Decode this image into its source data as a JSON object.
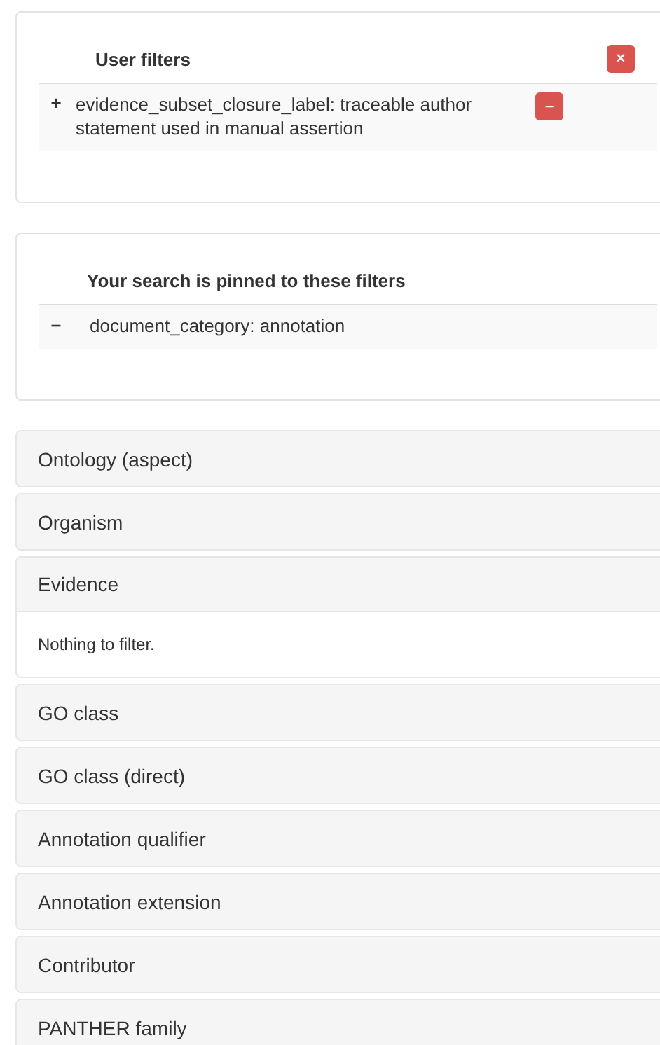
{
  "user_filters": {
    "title": "User filters",
    "clear_button": "×",
    "items": [
      {
        "sign": "+",
        "text": "evidence_subset_closure_label: traceable author statement used in manual assertion",
        "remove_button": "–"
      }
    ]
  },
  "pinned_filters": {
    "title": "Your search is pinned to these filters",
    "items": [
      {
        "sign": "–",
        "text": "document_category: annotation"
      }
    ]
  },
  "facets": [
    {
      "label": "Ontology (aspect)",
      "expanded": false
    },
    {
      "label": "Organism",
      "expanded": false
    },
    {
      "label": "Evidence",
      "expanded": true,
      "body": "Nothing to filter."
    },
    {
      "label": "GO class",
      "expanded": false
    },
    {
      "label": "GO class (direct)",
      "expanded": false
    },
    {
      "label": "Annotation qualifier",
      "expanded": false
    },
    {
      "label": "Annotation extension",
      "expanded": false
    },
    {
      "label": "Contributor",
      "expanded": false
    },
    {
      "label": "PANTHER family",
      "expanded": false
    }
  ]
}
